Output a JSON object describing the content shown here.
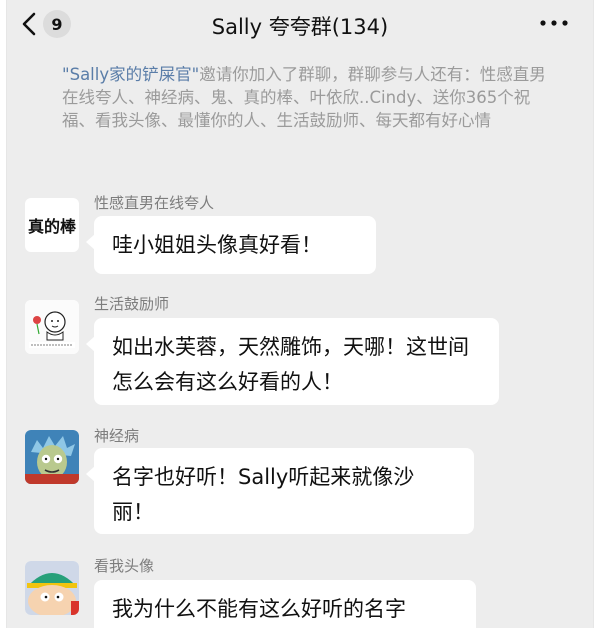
{
  "header": {
    "unread_count": "9",
    "title": "Sally 夸夸群(134)",
    "more_icon": "more-dots-icon",
    "back_icon": "chevron-left-icon"
  },
  "system_message": {
    "inviter": "\"Sally家的铲屎官\"",
    "text": "邀请你加入了群聊，群聊参与人还有：性感直男在线夸人、神经病、鬼、真的棒、叶依欣..Cindy、送你365个祝福、看我头像、最懂你的人、生活鼓励师、每天都有好心情"
  },
  "messages": [
    {
      "sender": "性感直男在线夸人",
      "avatar_text": "真的棒",
      "text": "哇小姐姐头像真好看！"
    },
    {
      "sender": "生活鼓励师",
      "avatar_text": "",
      "text": "如出水芙蓉，天然雕饰，天哪！这世间怎么会有这么好看的人！"
    },
    {
      "sender": "神经病",
      "avatar_text": "",
      "text": "名字也好听！Sally听起来就像沙丽！"
    },
    {
      "sender": "看我头像",
      "avatar_text": "",
      "text": "我为什么不能有这么好听的名字"
    }
  ],
  "colors": {
    "background": "#ededed",
    "bubble": "#ffffff",
    "link": "#5a7da8"
  }
}
